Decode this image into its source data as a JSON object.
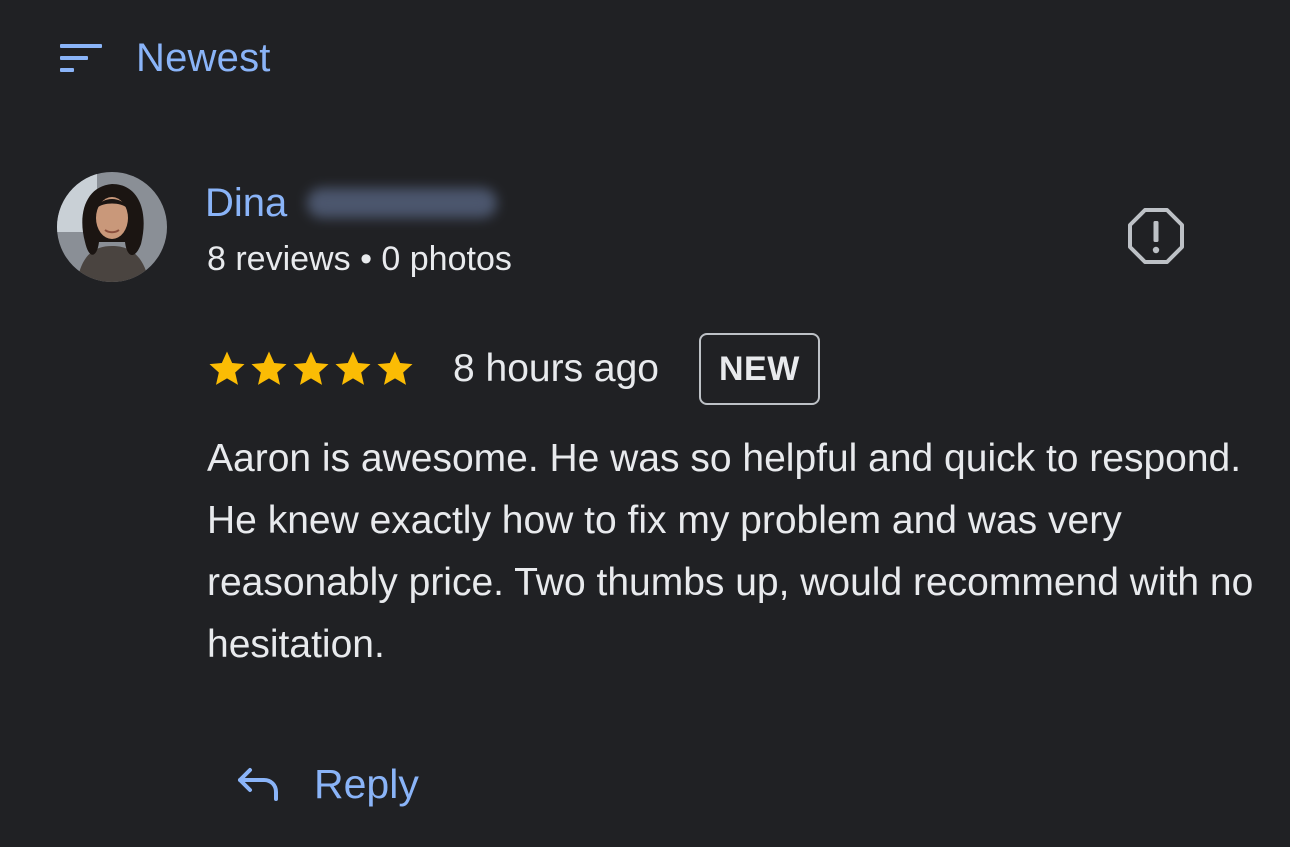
{
  "sort": {
    "icon": "sort-icon",
    "label": "Newest"
  },
  "review": {
    "reviewer": {
      "first_name": "Dina",
      "last_name_hidden": true,
      "review_count": "8 reviews",
      "separator": "•",
      "photo_count": "0 photos",
      "avatar": "user-avatar-photo"
    },
    "report_icon": "report-flag-icon",
    "rating": 5,
    "rating_max": 5,
    "time_ago": "8 hours ago",
    "badge": "NEW",
    "text": "Aaron is awesome. He was so helpful and quick to respond. He knew exactly how to fix my problem and was very reasonably price. Two thumbs up, would recommend with no hesitation.",
    "reply": {
      "icon": "reply-arrow-icon",
      "label": "Reply"
    }
  },
  "colors": {
    "background": "#202124",
    "accent": "#8ab4f8",
    "text": "#e8eaed",
    "star": "#fbbc04"
  }
}
